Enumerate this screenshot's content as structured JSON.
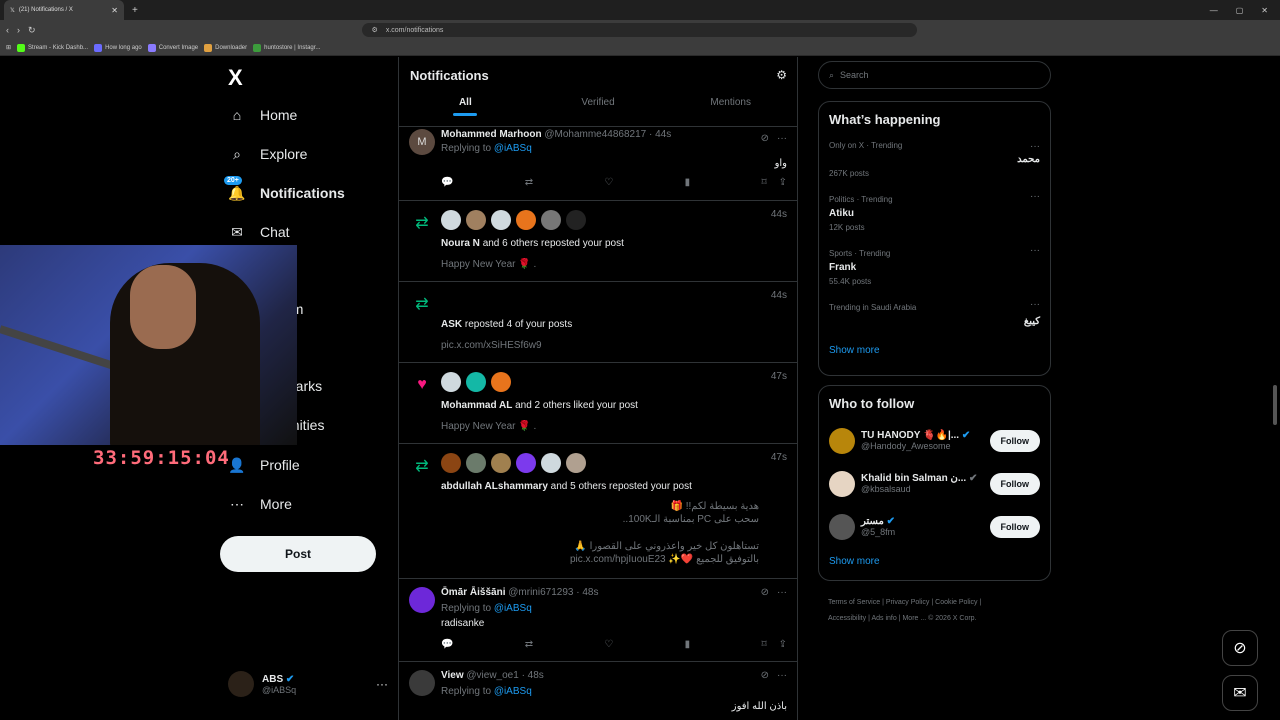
{
  "browser": {
    "tab_title": "(21) Notifications / X",
    "url": "x.com/notifications",
    "bookmarks": [
      "Stream - Kick Dashb...",
      "How long ago",
      "Convert Image",
      "Downloader",
      "huntostore | Instagr..."
    ]
  },
  "nav": {
    "logo": "X",
    "items": [
      "Home",
      "Explore",
      "Notifications",
      "Chat",
      "um",
      "marks",
      "unities",
      "Profile",
      "More"
    ],
    "notif_badge": "20+",
    "post_label": "Post",
    "account_name": "ABS",
    "account_handle": "@iABSq"
  },
  "timer": "33:59:15:04",
  "notifications": {
    "title": "Notifications",
    "tabs": [
      "All",
      "Verified",
      "Mentions"
    ],
    "items": [
      {
        "name": "Mohammed Marhoon",
        "meta": "@Mohamme44868217 · 44s",
        "reply_to_label": "Replying to",
        "reply_to": "@iABSq",
        "text": "واو"
      },
      {
        "time": "44s",
        "actor": "Noura N",
        "action": "and 6 others reposted your post",
        "sub": "Happy New Year 🌹 ."
      },
      {
        "time": "44s",
        "actor": "ASK",
        "action": "reposted 4 of your posts",
        "sub": "pic.x.com/xSiHESf6w9"
      },
      {
        "time": "47s",
        "actor": "Mohammad AL",
        "action": "and 2 others liked your post",
        "sub": "Happy New Year 🌹 ."
      },
      {
        "time": "47s",
        "actor": "abdullah ALshammary",
        "action": "and 5 others reposted your post",
        "lines": [
          "هدية بسيطة لكم!! 🎁",
          "سحب على PC بمناسبة الـ100K..",
          "تستاهلون كل خير واعذروني على القصورا 🙏",
          "بالتوفيق للجميع ❤️✨ pic.x.com/hpjIuouE23"
        ]
      },
      {
        "name": "Ōmār Āiššāni",
        "meta": "@mrini671293 · 48s",
        "reply_to_label": "Replying to",
        "reply_to": "@iABSq",
        "text": "radisanke"
      },
      {
        "name": "View",
        "meta": "@view_oe1 · 48s",
        "reply_to_label": "Replying to",
        "reply_to": "@iABSq",
        "text": "باذن الله افوز"
      }
    ]
  },
  "right": {
    "search_placeholder": "Search",
    "happening_title": "What’s happening",
    "trends": [
      {
        "meta": "Only on X · Trending",
        "title": "محمد",
        "count": "267K posts"
      },
      {
        "meta": "Politics · Trending",
        "title": "Atiku",
        "count": "12K posts"
      },
      {
        "meta": "Sports · Trending",
        "title": "Frank",
        "count": "55.4K posts"
      },
      {
        "meta": "Trending in Saudi Arabia",
        "title": "كيبغ",
        "count": ""
      }
    ],
    "show_more": "Show more",
    "who_title": "Who to follow",
    "who": [
      {
        "name": "TU HANODY 🫀🔥|...",
        "handle": "@Handody_Awesome",
        "btn": "Follow"
      },
      {
        "name": "Khalid bin Salman ن...",
        "handle": "@kbsalsaud",
        "btn": "Follow"
      },
      {
        "name": "مستر",
        "handle": "@5_8fm",
        "btn": "Follow"
      }
    ],
    "footer": [
      "Terms of Service",
      "Privacy Policy",
      "Cookie Policy",
      "Accessibility",
      "Ads info",
      "More ...",
      "© 2026 X Corp."
    ]
  },
  "colors": {
    "accent": "#1d9bf0",
    "green": "#00ba7c",
    "pink": "#f91880"
  }
}
